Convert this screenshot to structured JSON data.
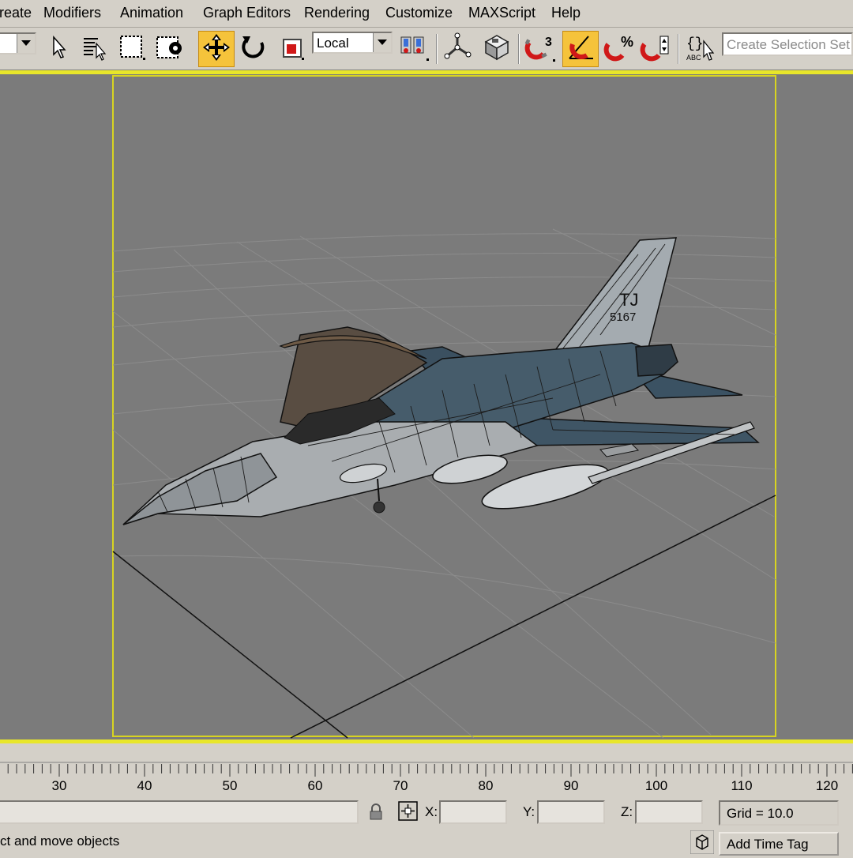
{
  "menu": [
    "reate",
    "Modifiers",
    "Animation",
    "Graph Editors",
    "Rendering",
    "Customize",
    "MAXScript",
    "Help"
  ],
  "toolbar": {
    "reference_coord": "Local",
    "selection_set_placeholder": "Create Selection Set",
    "snap_label": "3",
    "percent_label": "%",
    "named_sel_label": "ABC",
    "icons": [
      "selection-filter-dropdown",
      "select-object-icon",
      "select-by-name-icon",
      "rectangular-selection-icon",
      "window-crossing-icon",
      "select-and-move-icon",
      "select-and-rotate-icon",
      "select-and-scale-icon",
      "reference-coordinate-dropdown",
      "use-pivot-center-icon",
      "select-and-manipulate-icon",
      "keyboard-shortcut-override-icon",
      "snaps-toggle-icon",
      "angle-snap-toggle-icon",
      "percent-snap-toggle-icon",
      "spinner-snap-toggle-icon",
      "edit-named-selection-icon",
      "create-selection-set-field"
    ],
    "active": "select-and-move-icon",
    "active_color": "#f5c33b"
  },
  "viewport": {
    "background": "#7b7b7b",
    "frame_color": "#e8e62a",
    "tail_code_1": "TJ",
    "tail_code_2": "5167"
  },
  "timeline": {
    "ticks": [
      "30",
      "40",
      "50",
      "60",
      "70",
      "80",
      "90",
      "100",
      "110",
      "120"
    ]
  },
  "status": {
    "x_label": "X:",
    "y_label": "Y:",
    "z_label": "Z:",
    "grid": "Grid = 10.0",
    "prompt": "ct and move objects",
    "time_tag": "Add Time Tag"
  }
}
